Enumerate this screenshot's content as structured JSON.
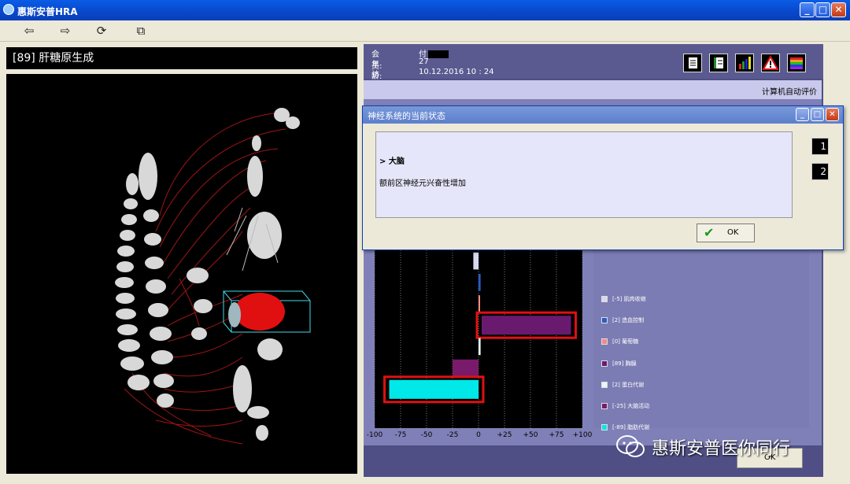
{
  "app": {
    "title": "惠斯安普HRA"
  },
  "window_controls": {
    "minimize": "_",
    "maximize": "□",
    "close": "✕"
  },
  "toolbar": {
    "back_icon": "⇦",
    "forward_icon": "⇨",
    "refresh_icon": "⟳",
    "compare_icon": "⧉"
  },
  "left": {
    "organ_title": "[89] 肝糖原生成"
  },
  "patient": {
    "member_label": "会员:",
    "member_value": "付",
    "age_label": "年龄:",
    "age_value": "27",
    "visit_label": "访问:",
    "visit_value": "10.12.2016  10 : 24"
  },
  "header_icons": [
    "document-icon",
    "list-icon",
    "bar-chart-icon",
    "warning-icon",
    "spectrum-icon"
  ],
  "evaluation_label": "计算机自动评价",
  "dialog": {
    "title": "神经系统的当前状态",
    "heading": "> 大脑",
    "text": "额前区神经元兴奋性增加",
    "side_buttons": [
      "1",
      "2"
    ],
    "ok_label": "OK"
  },
  "background_ok_label": "OK",
  "legend": [
    {
      "label": "[-5] 肌肉收缩",
      "color": "#d8d8f0"
    },
    {
      "label": "[2] 造血控制",
      "color": "#2a5cc8"
    },
    {
      "label": "[0] 葡萄糖",
      "color": "#f08a8a"
    },
    {
      "label": "[89] 胸腺",
      "color": "#6a1a6e"
    },
    {
      "label": "[2] 蛋白代谢",
      "color": "#e8f8f8"
    },
    {
      "label": "[-25] 大脑活动",
      "color": "#7a1a6a"
    },
    {
      "label": "[-89] 脂肪代谢",
      "color": "#00e8e8"
    }
  ],
  "chart_data": {
    "type": "bar",
    "orientation": "horizontal",
    "categories": [
      "[-5] 肌肉收缩",
      "[2] 造血控制",
      "[0] 葡萄糖",
      "[89] 胸腺",
      "[2] 蛋白代谢",
      "[-25] 大脑活动",
      "[-89] 脂肪代谢"
    ],
    "values": [
      -5,
      2,
      0,
      89,
      2,
      -25,
      -89
    ],
    "colors": [
      "#d8d8f0",
      "#2a5cc8",
      "#f08a8a",
      "#6a1a6e",
      "#e8f8f8",
      "#7a1a6a",
      "#00e8e8"
    ],
    "highlighted": [
      3,
      6
    ],
    "xlim": [
      -100,
      100
    ],
    "xticks": [
      "-100",
      "-75",
      "-50",
      "-25",
      "0",
      "+25",
      "+50",
      "+75",
      "+100"
    ],
    "grid": true
  },
  "watermark": {
    "text": "惠斯安普医你同行"
  }
}
